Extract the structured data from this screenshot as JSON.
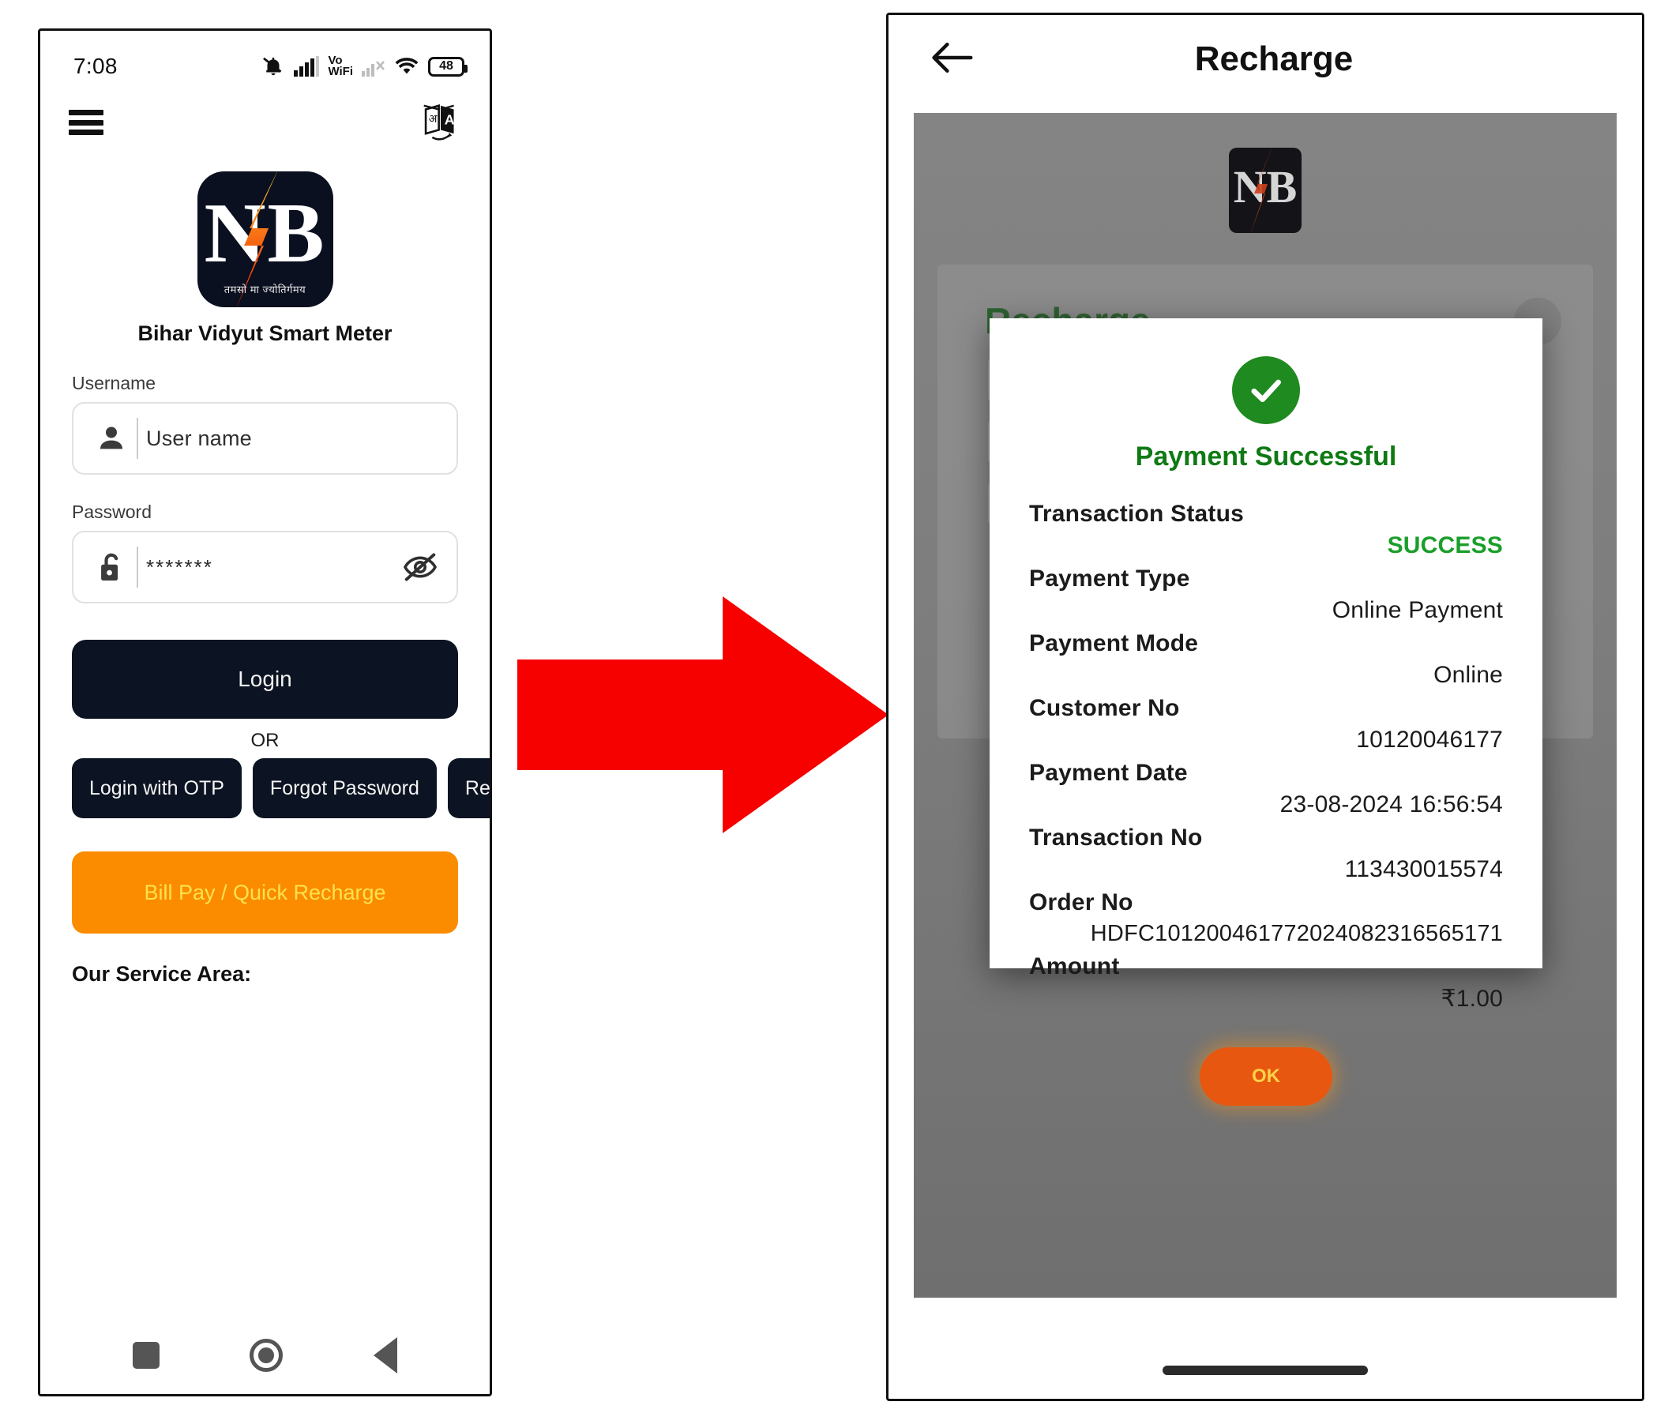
{
  "left_phone": {
    "status_bar": {
      "time": "7:08",
      "battery_level": "48",
      "icons": [
        "bell-muted-icon",
        "signal-bars-icon",
        "vowifi-icon",
        "signal-no-service-icon",
        "wifi-icon",
        "battery-icon"
      ],
      "vowifi_top": "Vo",
      "vowifi_bottom": "WiFi"
    },
    "app_bar": {
      "menu_icon": "hamburger-menu-icon",
      "translate_icon": "translate-language-icon"
    },
    "brand": {
      "logo_letters": "NB",
      "logo_tagline": "तमसो मा ज्योतिर्गमय",
      "app_title": "Bihar Vidyut Smart Meter"
    },
    "form": {
      "username_label": "Username",
      "username_placeholder": "User name",
      "username_value": "",
      "username_icon": "person-icon",
      "password_label": "Password",
      "password_value": "*******",
      "password_icon": "unlock-padlock-icon",
      "password_toggle_icon": "eye-off-icon"
    },
    "actions": {
      "login": "Login",
      "or": "OR",
      "login_with_otp": "Login with OTP",
      "forgot_password": "Forgot Password",
      "register": "Register",
      "bill_pay": "Bill Pay / Quick Recharge"
    },
    "footer": {
      "service_area": "Our Service Area:"
    },
    "nav_bar": {
      "recents_icon": "square-recents-icon",
      "home_icon": "circle-home-icon",
      "back_icon": "triangle-back-icon"
    }
  },
  "transition": {
    "arrow_icon": "right-arrow-icon",
    "arrow_color": "#f70000"
  },
  "right_phone": {
    "app_bar": {
      "back_icon": "back-arrow-icon",
      "title": "Recharge"
    },
    "background": {
      "logo_letters": "NB",
      "card_heading": "Recharge"
    },
    "dialog": {
      "check_icon": "success-check-icon",
      "title": "Payment Successful",
      "rows": [
        {
          "label": "Transaction Status",
          "value": "SUCCESS",
          "highlight": true
        },
        {
          "label": "Payment Type",
          "value": "Online Payment",
          "highlight": false
        },
        {
          "label": "Payment Mode",
          "value": "Online",
          "highlight": false
        },
        {
          "label": "Customer No",
          "value": "10120046177",
          "highlight": false
        },
        {
          "label": "Payment Date",
          "value": "23-08-2024 16:56:54",
          "highlight": false
        },
        {
          "label": "Transaction No",
          "value": "113430015574",
          "highlight": false
        },
        {
          "label": "Order No",
          "value": "HDFC101200461772024082316565171",
          "highlight": false
        },
        {
          "label": "Amount",
          "value": "₹1.00",
          "highlight": false
        }
      ],
      "ok_label": "OK"
    },
    "home_indicator_icon": "home-indicator-bar"
  },
  "colors": {
    "dark_button": "#0c1322",
    "orange": "#fb8c00",
    "orange_yellow_text": "#ffe24d",
    "success_green": "#1a9e2a",
    "heading_green": "#0f7a14",
    "arrow_red": "#f70000"
  }
}
